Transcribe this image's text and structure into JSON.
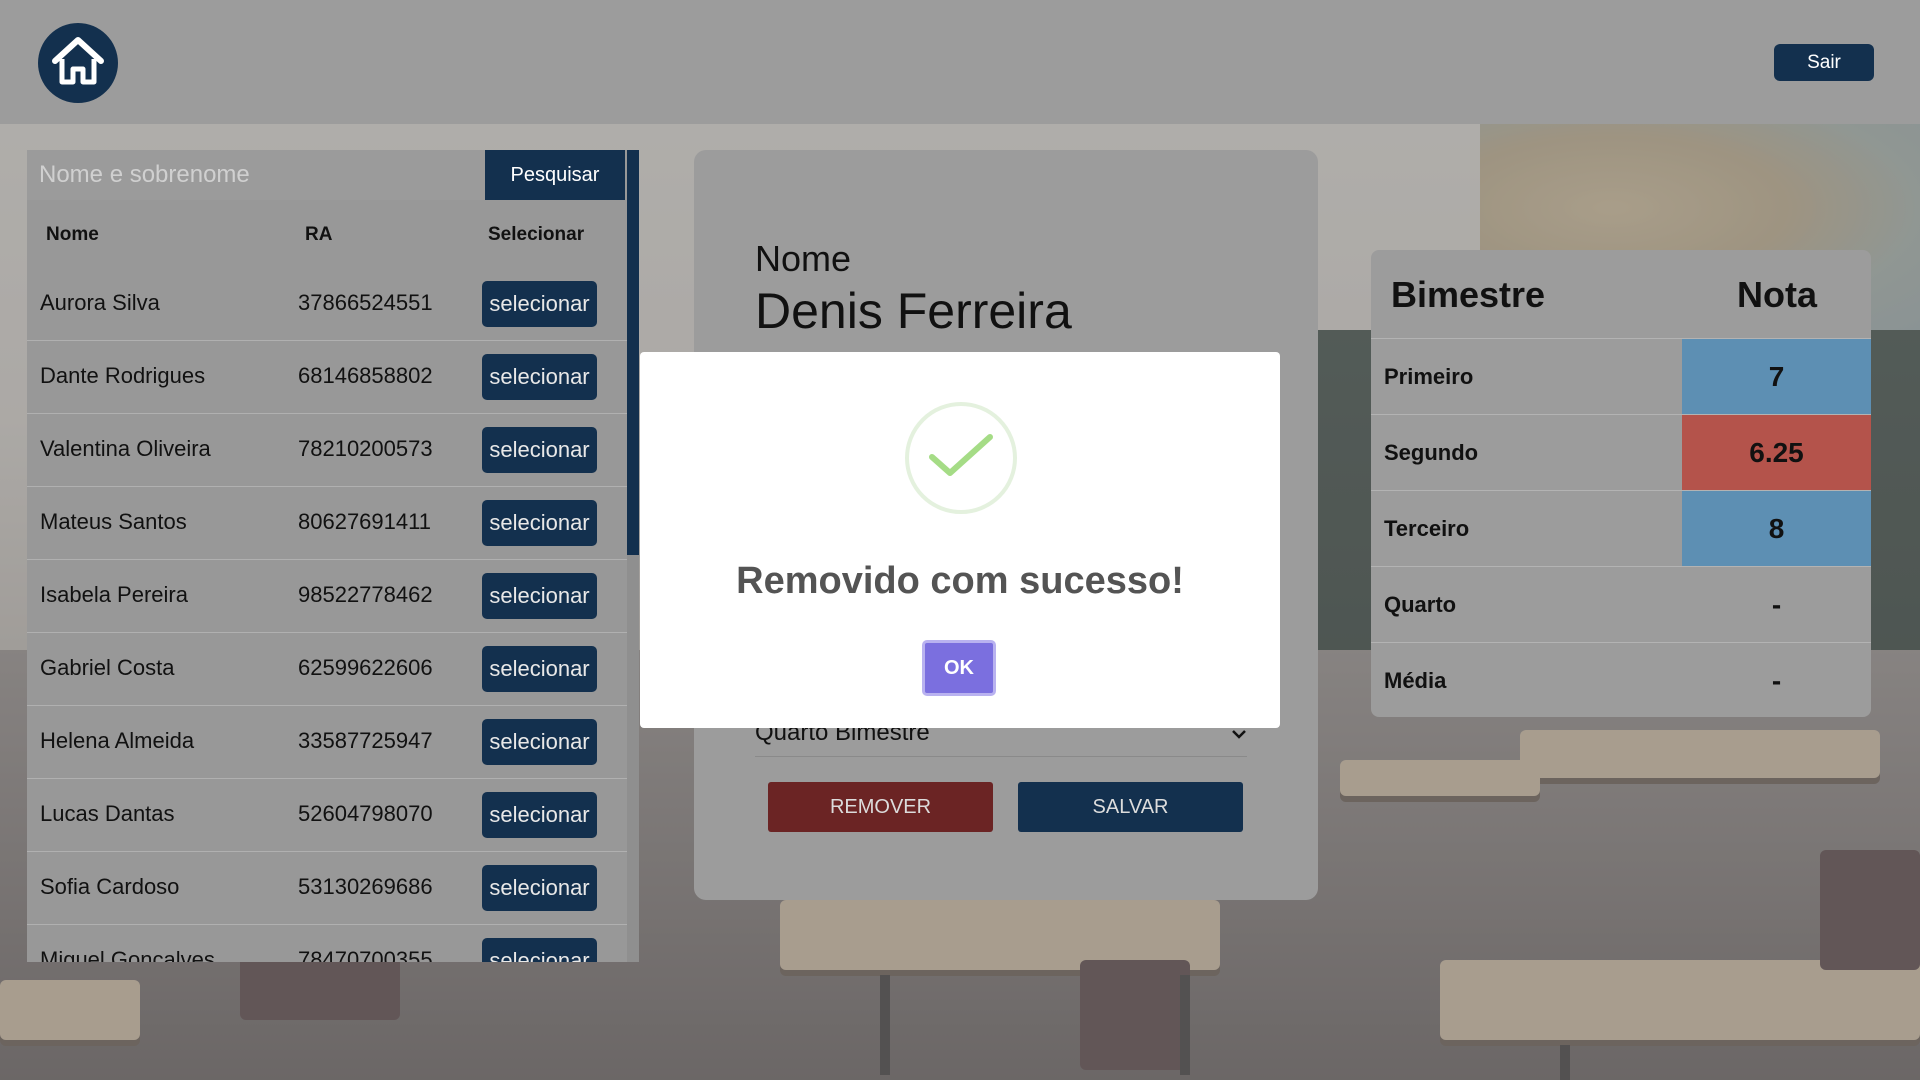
{
  "header": {
    "home_icon": "home-icon",
    "logout_label": "Sair"
  },
  "search": {
    "placeholder": "Nome e sobrenome",
    "button_label": "Pesquisar"
  },
  "students_table": {
    "columns": [
      "Nome",
      "RA",
      "Selecionar"
    ],
    "select_label": "selecionar",
    "rows": [
      {
        "name": "Aurora Silva",
        "ra": "37866524551"
      },
      {
        "name": "Dante Rodrigues",
        "ra": "68146858802"
      },
      {
        "name": "Valentina Oliveira",
        "ra": "78210200573"
      },
      {
        "name": "Mateus Santos",
        "ra": "80627691411"
      },
      {
        "name": "Isabela Pereira",
        "ra": "98522778462"
      },
      {
        "name": "Gabriel Costa",
        "ra": "62599622606"
      },
      {
        "name": "Helena Almeida",
        "ra": "33587725947"
      },
      {
        "name": "Lucas Dantas",
        "ra": "52604798070"
      },
      {
        "name": "Sofia Cardoso",
        "ra": "53130269686"
      },
      {
        "name": "Miguel Gonçalves",
        "ra": "78470700355"
      }
    ]
  },
  "form": {
    "name_label": "Nome",
    "name_value": "Denis Ferreira",
    "bimester_select": "Quarto Bimestre",
    "remove_label": "REMOVER",
    "save_label": "SALVAR"
  },
  "grades": {
    "header_bimester": "Bimestre",
    "header_grade": "Nota",
    "rows": [
      {
        "label": "Primeiro",
        "value": "7",
        "color": "#5d8fb3"
      },
      {
        "label": "Segundo",
        "value": "6.25",
        "color": "#b4534b"
      },
      {
        "label": "Terceiro",
        "value": "8",
        "color": "#5d8fb3"
      },
      {
        "label": "Quarto",
        "value": "-",
        "color": ""
      },
      {
        "label": "Média",
        "value": "-",
        "color": ""
      }
    ]
  },
  "modal": {
    "icon": "check-icon",
    "title": "Removido com sucesso!",
    "ok_label": "OK"
  },
  "colors": {
    "primary": "#13304e",
    "danger": "#6b2424",
    "modal_button": "#7b6fdf"
  }
}
